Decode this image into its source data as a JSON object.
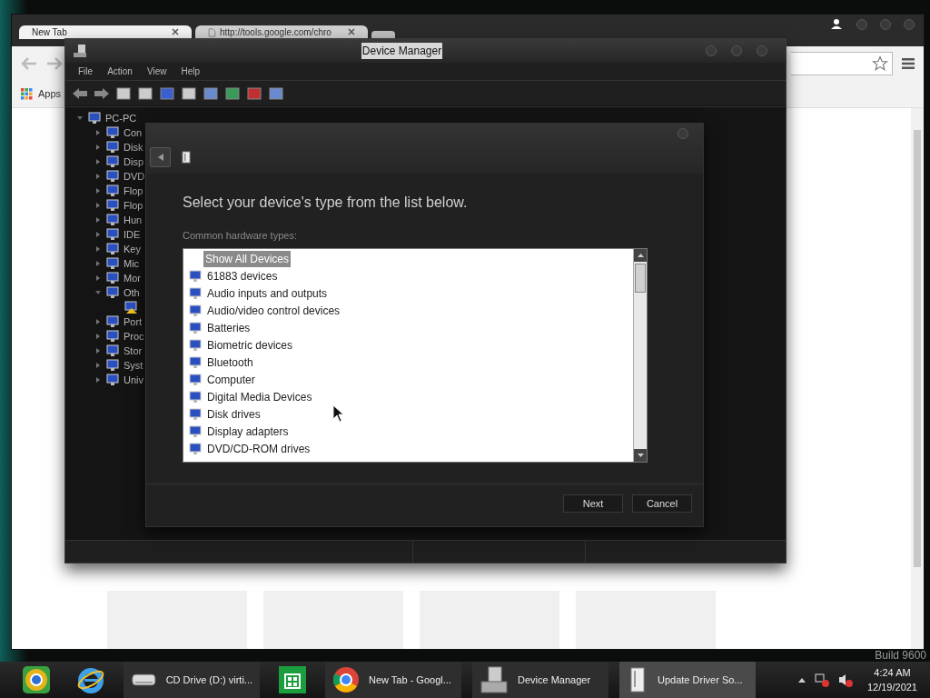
{
  "browser": {
    "tabs": [
      {
        "title": "New Tab",
        "selected": true
      },
      {
        "title": "http://tools.google.com/chro",
        "selected": false
      }
    ],
    "bookmarks": [
      "Apps"
    ]
  },
  "device_manager": {
    "title": "Device Manager",
    "menu": [
      "File",
      "Action",
      "View",
      "Help"
    ],
    "tree": {
      "label": "PC-PC",
      "expanded": true,
      "children": [
        {
          "label": "Con",
          "expanded": false
        },
        {
          "label": "Disk",
          "expanded": false
        },
        {
          "label": "Disp",
          "expanded": false
        },
        {
          "label": "DVD",
          "expanded": false
        },
        {
          "label": "Flop",
          "expanded": false
        },
        {
          "label": "Flop",
          "expanded": false
        },
        {
          "label": "Hun",
          "expanded": false
        },
        {
          "label": "IDE",
          "expanded": false
        },
        {
          "label": "Key",
          "expanded": false
        },
        {
          "label": "Mic",
          "expanded": false
        },
        {
          "label": "Mor",
          "expanded": false
        },
        {
          "label": "Oth",
          "expanded": true,
          "children": [
            {
              "kind": "warning"
            }
          ]
        },
        {
          "label": "Port",
          "expanded": false
        },
        {
          "label": "Proc",
          "expanded": false
        },
        {
          "label": "Stor",
          "expanded": false
        },
        {
          "label": "Syst",
          "expanded": false
        },
        {
          "label": "Univ",
          "expanded": false
        }
      ]
    }
  },
  "dialog": {
    "heading": "Select your device's type from the list below.",
    "list_label": "Common hardware types:",
    "items": [
      {
        "label": "Show All Devices",
        "selected": true
      },
      {
        "label": "61883 devices",
        "selected": false
      },
      {
        "label": "Audio inputs and outputs",
        "selected": false
      },
      {
        "label": "Audio/video control devices",
        "selected": false
      },
      {
        "label": "Batteries",
        "selected": false
      },
      {
        "label": "Biometric devices",
        "selected": false
      },
      {
        "label": "Bluetooth",
        "selected": false
      },
      {
        "label": "Computer",
        "selected": false
      },
      {
        "label": "Digital Media Devices",
        "selected": false
      },
      {
        "label": "Disk drives",
        "selected": false
      },
      {
        "label": "Display adapters",
        "selected": false
      },
      {
        "label": "DVD/CD-ROM drives",
        "selected": false
      }
    ],
    "buttons": [
      "Next",
      "Cancel"
    ]
  },
  "watermark": "Build 9600",
  "taskbar": {
    "items": [
      {
        "kind": "chrome-round"
      },
      {
        "kind": "ie"
      },
      {
        "kind": "drive",
        "label": "CD Drive (D:) virti...",
        "selected": false
      },
      {
        "kind": "store"
      },
      {
        "kind": "chrome",
        "label": "New Tab - Googl...",
        "selected": false
      },
      {
        "kind": "device-manager",
        "label": "Device Manager",
        "selected": false
      },
      {
        "kind": "device",
        "label": "Update Driver So...",
        "selected": true
      }
    ],
    "time": "4:24 AM",
    "date": "12/19/2021"
  }
}
